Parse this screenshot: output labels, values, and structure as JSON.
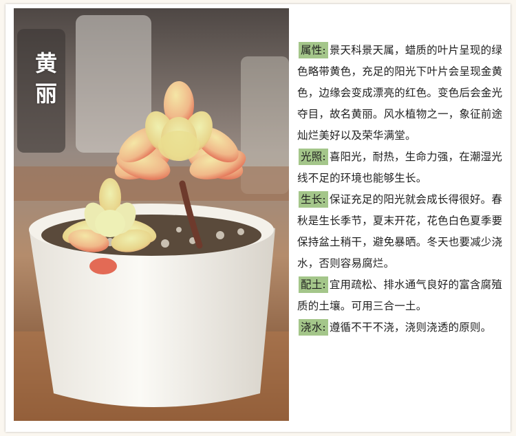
{
  "colors": {
    "tag_background": "#a4c68a",
    "card_background": "#ffffff",
    "page_background": "#fbf7f0"
  },
  "photo": {
    "title_chars": [
      "黄",
      "丽"
    ]
  },
  "sections": [
    {
      "tag": "属性:",
      "text": "景天科景天属，蜡质的叶片呈现的绿色略带黄色，充足的阳光下叶片会呈现金黄色，边缘会变成漂亮的红色。变色后会金光夺目，故名黄丽。风水植物之一，象征前途灿烂美好以及荣华满堂。"
    },
    {
      "tag": "光照:",
      "text": "喜阳光，耐热，生命力强，在潮湿光线不足的环境也能够生长。"
    },
    {
      "tag": "生长:",
      "text": "保证充足的阳光就会成长得很好。春秋是生长季节，夏末开花，花色白色夏季要保持盆土稍干，避免暴晒。冬天也要减少浇水，否则容易腐烂。"
    },
    {
      "tag": "配土:",
      "text": "宜用疏松、排水通气良好的富含腐殖质的土壤。可用三合一土。"
    },
    {
      "tag": "浇水:",
      "text": "遵循不干不浇，浇则浇透的原则。"
    }
  ]
}
